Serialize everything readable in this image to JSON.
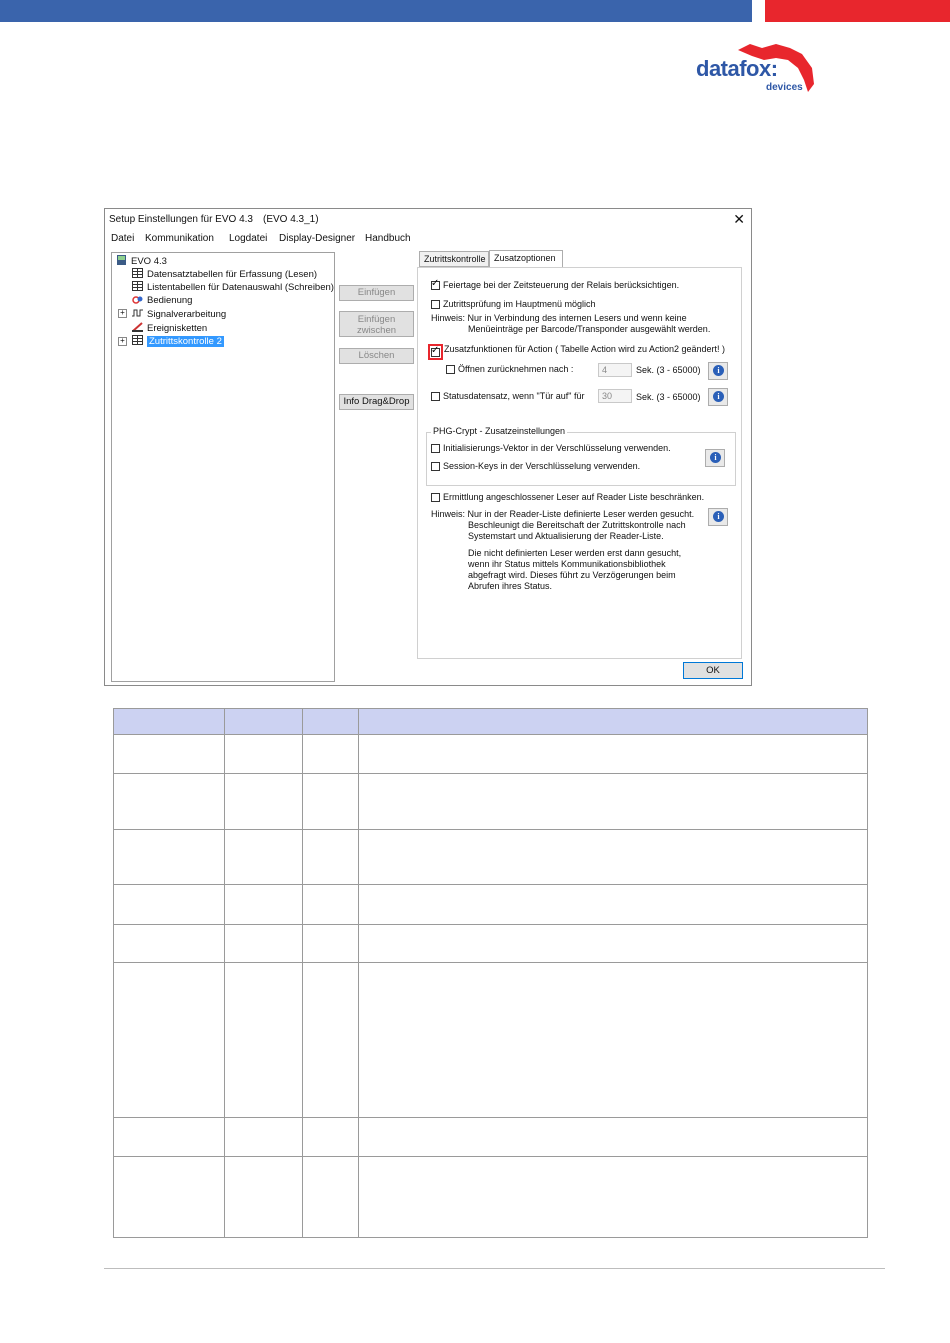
{
  "brand": {
    "logo_text": "datafox:",
    "logo_sub": "devices",
    "blue": "#3a64ac",
    "red": "#e8262d"
  },
  "window": {
    "title": "Setup Einstellungen für EVO 4.3",
    "title_suffix": "(EVO 4.3_1)",
    "close": "✕",
    "menu": [
      "Datei",
      "Kommunikation",
      "Logdatei",
      "Display-Designer",
      "Handbuch"
    ],
    "tree": [
      {
        "label": "EVO 4.3",
        "icon": "device-icon"
      },
      {
        "label": "Datensatztabellen für Erfassung (Lesen)",
        "icon": "table-icon"
      },
      {
        "label": "Listentabellen für Datenauswahl (Schreiben)",
        "icon": "table-icon"
      },
      {
        "label": "Bedienung",
        "icon": "operation-icon"
      },
      {
        "label": "Signalverarbeitung",
        "icon": "signal-icon"
      },
      {
        "label": "Ereignisketten",
        "icon": "event-chain-icon"
      },
      {
        "label": "Zutrittskontrolle 2",
        "icon": "table-icon"
      }
    ],
    "buttons": {
      "insert": "Einfügen",
      "insert_between_1": "Einfügen",
      "insert_between_2": "zwischen",
      "delete": "Löschen",
      "info_drag": "Info Drag&Drop"
    },
    "tabs": [
      "Zutrittskontrolle",
      "Zusatzoptionen"
    ],
    "options": {
      "holidays": "Feiertage bei der Zeitsteuerung der Relais berücksichtigen.",
      "main_menu": "Zutrittsprüfung im Hauptmenü möglich",
      "hint_label": "Hinweis:",
      "hint1_line1": "Nur in Verbindung des internen Lesers und wenn keine",
      "hint1_line2": "Menüeinträge per Barcode/Transponder ausgewählt werden.",
      "action_functions": "Zusatzfunktionen für Action ( Tabelle Action wird zu Action2 geändert! )",
      "undo_open": "Öffnen zurücknehmen nach :",
      "undo_open_value": "4",
      "undo_open_range": "Sek. (3 - 65000)",
      "status_record": "Statusdatensatz, wenn \"Tür auf\" für",
      "status_value": "30",
      "status_range": "Sek. (3 - 65000)",
      "phg_group": "PHG-Crypt - Zusatzeinstellungen",
      "init_vector": "Initialisierungs-Vektor in der Verschlüsselung verwenden.",
      "session_keys": "Session-Keys in der Verschlüsselung verwenden.",
      "reader_list": "Ermittlung angeschlossener Leser auf Reader Liste beschränken.",
      "hint2_line1": "Nur in der Reader-Liste definierte Leser werden gesucht.",
      "hint2_line2": "Beschleunigt die Bereitschaft der Zutrittskontrolle nach",
      "hint2_line3": "Systemstart und Aktualisierung der Reader-Liste.",
      "hint2_line4": "Die nicht definierten Leser werden erst dann gesucht,",
      "hint2_line5": "wenn ihr Status mittels Kommunikationsbibliothek",
      "hint2_line6": "abgefragt wird. Dieses führt zu Verzögerungen beim",
      "hint2_line7": "Abrufen ihres Status."
    },
    "ok": "OK"
  }
}
